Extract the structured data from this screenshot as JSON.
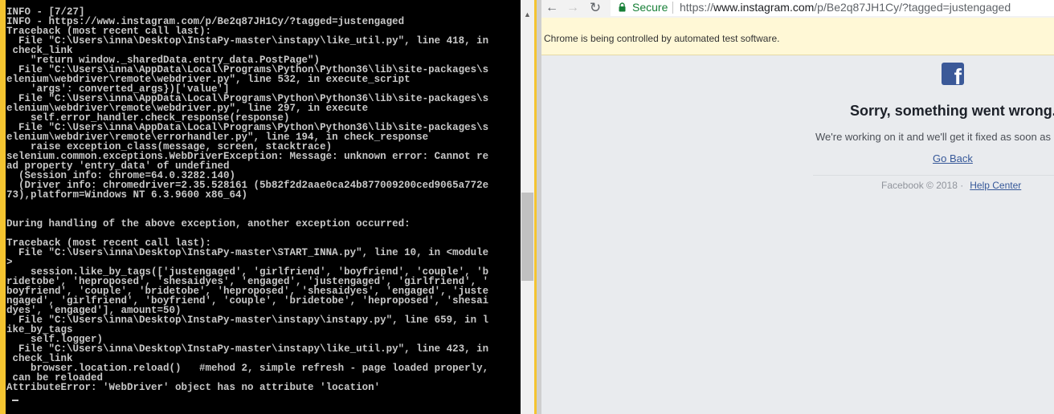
{
  "console": {
    "lines": [
      "INFO - [7/27]",
      "INFO - https://www.instagram.com/p/Be2q87JH1Cy/?tagged=justengaged",
      "Traceback (most recent call last):",
      "  File \"C:\\Users\\inna\\Desktop\\InstaPy-master\\instapy\\like_util.py\", line 418, in",
      " check_link",
      "    \"return window._sharedData.entry_data.PostPage\")",
      "  File \"C:\\Users\\inna\\AppData\\Local\\Programs\\Python\\Python36\\lib\\site-packages\\s",
      "elenium\\webdriver\\remote\\webdriver.py\", line 532, in execute_script",
      "    'args': converted_args})['value']",
      "  File \"C:\\Users\\inna\\AppData\\Local\\Programs\\Python\\Python36\\lib\\site-packages\\s",
      "elenium\\webdriver\\remote\\webdriver.py\", line 297, in execute",
      "    self.error_handler.check_response(response)",
      "  File \"C:\\Users\\inna\\AppData\\Local\\Programs\\Python\\Python36\\lib\\site-packages\\s",
      "elenium\\webdriver\\remote\\errorhandler.py\", line 194, in check_response",
      "    raise exception_class(message, screen, stacktrace)",
      "selenium.common.exceptions.WebDriverException: Message: unknown error: Cannot re",
      "ad property 'entry_data' of undefined",
      "  (Session info: chrome=64.0.3282.140)",
      "  (Driver info: chromedriver=2.35.528161 (5b82f2d2aae0ca24b877009200ced9065a772e",
      "73),platform=Windows NT 6.3.9600 x86_64)",
      "",
      "",
      "During handling of the above exception, another exception occurred:",
      "",
      "Traceback (most recent call last):",
      "  File \"C:\\Users\\inna\\Desktop\\InstaPy-master\\START_INNA.py\", line 10, in <module",
      ">",
      "    session.like_by_tags(['justengaged', 'girlfriend', 'boyfriend', 'couple', 'b",
      "ridetobe', 'heproposed', 'shesaidyes', 'engaged', 'justengaged', 'girlfriend', '",
      "boyfriend', 'couple', 'bridetobe', 'heproposed', 'shesaidyes', 'engaged', 'juste",
      "ngaged', 'girlfriend', 'boyfriend', 'couple', 'bridetobe', 'heproposed', 'shesai",
      "dyes', 'engaged'], amount=50)",
      "  File \"C:\\Users\\inna\\Desktop\\InstaPy-master\\instapy\\instapy.py\", line 659, in l",
      "ike_by_tags",
      "    self.logger)",
      "  File \"C:\\Users\\inna\\Desktop\\InstaPy-master\\instapy\\like_util.py\", line 423, in",
      " check_link",
      "    browser.location.reload()   #mehod 2, simple refresh - page loaded properly,",
      " can be reloaded",
      "AttributeError: 'WebDriver' object has no attribute 'location'"
    ]
  },
  "browser": {
    "secure_label": "Secure",
    "url_scheme": "https://",
    "url_domain": "www.instagram.com",
    "url_path": "/p/Be2q87JH1Cy/?tagged=justengaged",
    "infobar_text": "Chrome is being controlled by automated test software.",
    "secure_color": "#188038",
    "brand_color": "#3b5998"
  },
  "page": {
    "logo_icon": "facebook-icon",
    "error_title": "Sorry, something went wrong.",
    "error_message": "We're working on it and we'll get it fixed as soon as",
    "go_back_label": "Go Back",
    "footer_copyright": "Facebook © 2018 ·",
    "help_center_label": "Help Center"
  }
}
